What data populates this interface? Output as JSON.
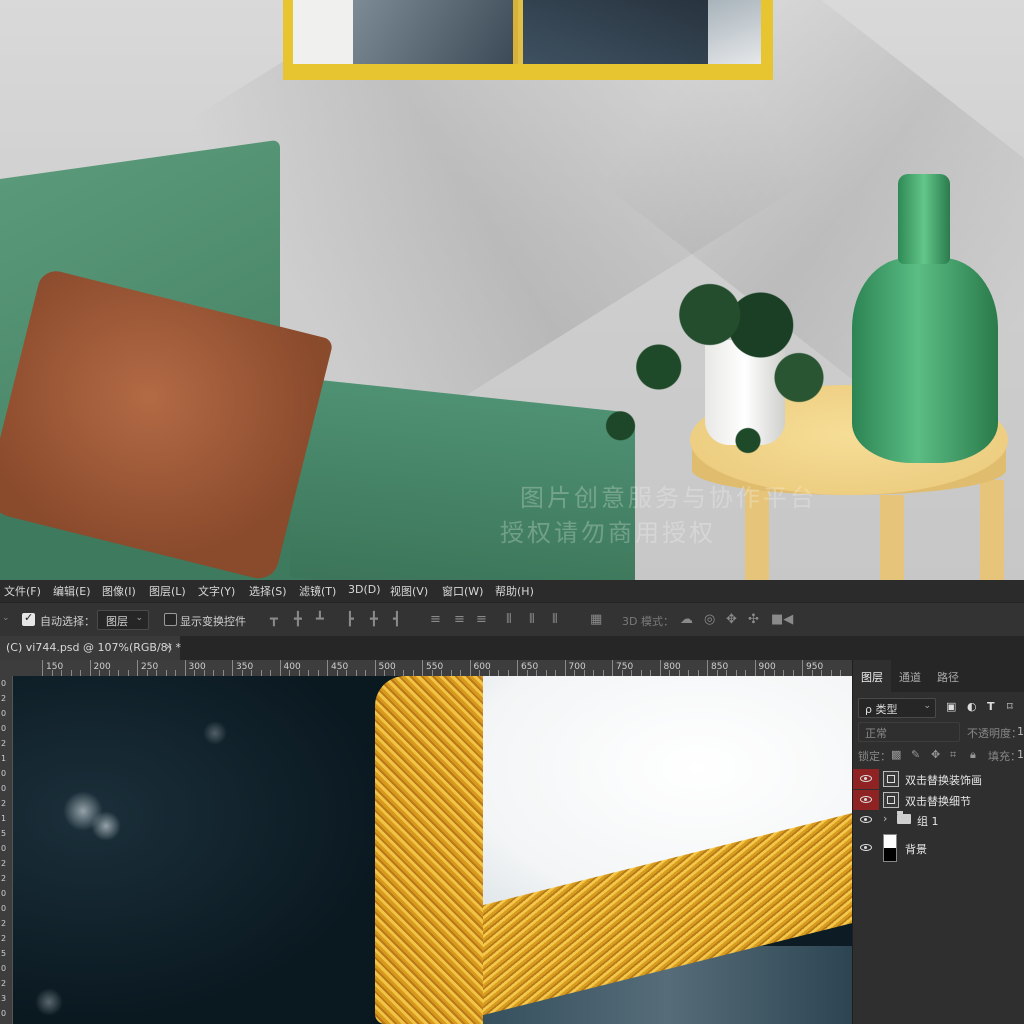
{
  "menu": [
    "文件(F)",
    "编辑(E)",
    "图像(I)",
    "图层(L)",
    "文字(Y)",
    "选择(S)",
    "滤镜(T)",
    "3D(D)",
    "视图(V)",
    "窗口(W)",
    "帮助(H)"
  ],
  "options_bar": {
    "auto_select_label": "自动选择：",
    "auto_select_checked": true,
    "auto_select_target": "图层",
    "show_transform_label": "显示变换控件",
    "show_transform_checked": false,
    "mode_3d_label": "3D 模式："
  },
  "document_tab": {
    "title": "(C) vi744.psd @ 107%(RGB/8) *",
    "close": "×"
  },
  "ruler_h": [
    "150",
    "200",
    "250",
    "300",
    "350",
    "400",
    "450",
    "500",
    "550",
    "600",
    "650",
    "700",
    "750",
    "800",
    "850",
    "900",
    "950"
  ],
  "ruler_v": [
    "0",
    "2",
    "0",
    "0",
    "2",
    "1",
    "0",
    "0",
    "2",
    "1",
    "5",
    "0",
    "2",
    "2",
    "0",
    "0",
    "2",
    "2",
    "5",
    "0",
    "2",
    "3",
    "0"
  ],
  "watermark": [
    "图片创意服务与协作平台",
    "授权请勿商用授权"
  ],
  "layers_panel": {
    "tabs": [
      "图层",
      "通道",
      "路径"
    ],
    "filter_label": "ρ 类型",
    "blend_mode": "正常",
    "opacity_label": "不透明度：",
    "opacity_value": "1",
    "lock_label": "锁定：",
    "fill_label": "填充：",
    "fill_value": "1",
    "layers": [
      {
        "name": "双击替换装饰画",
        "kind": "smart",
        "highlight": true
      },
      {
        "name": "双击替换细节",
        "kind": "smart",
        "highlight": true
      },
      {
        "name": "组 1",
        "kind": "group",
        "highlight": false
      },
      {
        "name": "背景",
        "kind": "background",
        "highlight": false
      }
    ]
  },
  "colors": {
    "menubar_bg": "#2b2b2b",
    "options_bg": "#333333",
    "highlight_red": "#8f2323",
    "gold": "#e6c531"
  }
}
